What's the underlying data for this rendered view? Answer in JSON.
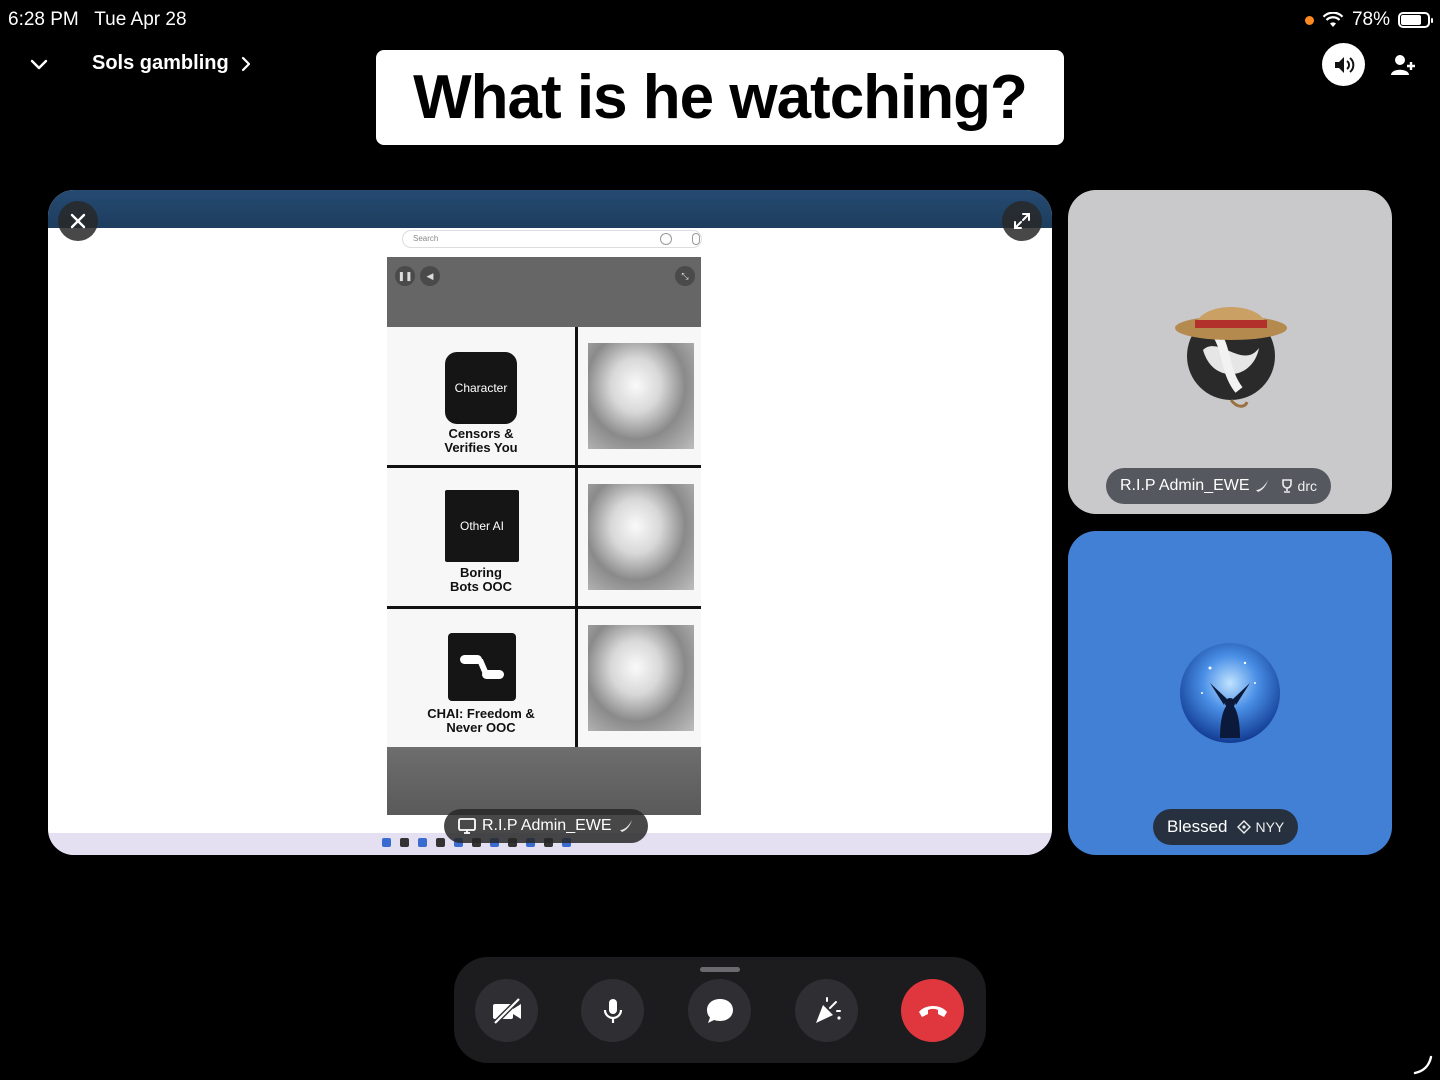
{
  "status": {
    "time": "6:28 PM",
    "date": "Tue Apr 28",
    "battery": "78%"
  },
  "header": {
    "channel_name": "Sols gambling",
    "caption": "What is he watching?"
  },
  "stream": {
    "streamer_label": "R.I.P Admin_EWE",
    "screen": {
      "search_placeholder": "Search",
      "rows": [
        {
          "logo_text": "Character",
          "caption": "Censors &\nVerifies You"
        },
        {
          "logo_text": "Other AI",
          "caption": "Boring\nBots OOC"
        },
        {
          "logo_text": "",
          "caption": "CHAI: Freedom &\nNever OOC"
        }
      ]
    }
  },
  "participants": [
    {
      "name": "R.I.P Admin_EWE",
      "tag": "drc",
      "tile_color": "#c9c9cc"
    },
    {
      "name": "Blessed",
      "tag": "NYY",
      "tile_color": "#4180d4"
    }
  ],
  "controls": {
    "buttons": [
      "camera-off",
      "microphone",
      "chat",
      "soundboard",
      "hang-up"
    ]
  },
  "colors": {
    "hangup": "#e0373f",
    "status_dot": "#ff8a1f",
    "blessed_tile": "#4180d4"
  }
}
